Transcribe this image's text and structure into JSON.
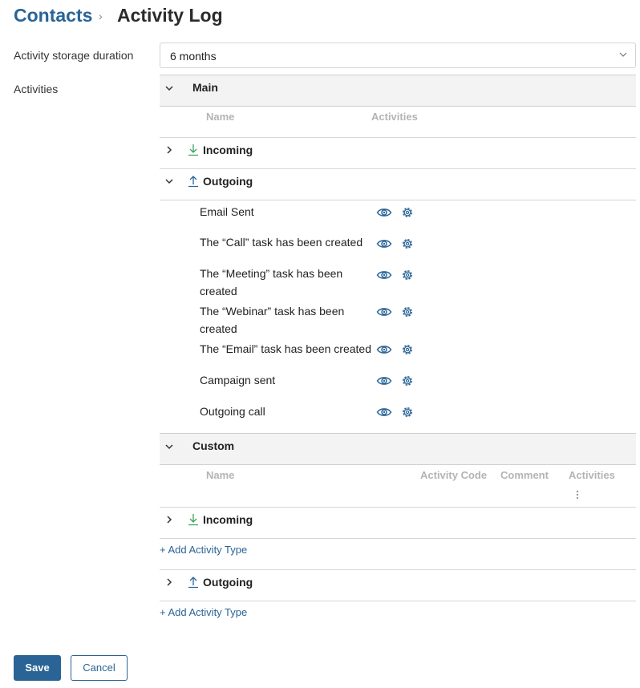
{
  "breadcrumb": {
    "root": "Contacts",
    "separator": "›",
    "title": "Activity Log"
  },
  "form": {
    "storage_label": "Activity storage duration",
    "storage_value": "6 months",
    "activities_label": "Activities"
  },
  "main_section": {
    "title": "Main",
    "columns": [
      "Name",
      "Activities"
    ],
    "incoming_label": "Incoming",
    "outgoing_label": "Outgoing",
    "outgoing_items": [
      "Email Sent",
      "The “Call” task has been created",
      "The “Meeting” task has been created",
      "The “Webinar” task has been created",
      "The “Email” task has been created",
      "Campaign sent",
      "Outgoing call"
    ]
  },
  "custom_section": {
    "title": "Custom",
    "columns": [
      "Name",
      "Activity Code",
      "Comment",
      "Activities"
    ],
    "incoming_label": "Incoming",
    "outgoing_label": "Outgoing",
    "add_label_1": "+ Add Activity Type",
    "add_label_2": "+ Add Activity Type"
  },
  "actions": {
    "save": "Save",
    "cancel": "Cancel"
  },
  "colors": {
    "accent": "#2a6496",
    "incoming_icon": "#3aa35a",
    "outgoing_icon": "#2a6496"
  },
  "icons": [
    "chevron-right-icon",
    "chevron-down-icon",
    "incoming-icon",
    "outgoing-icon",
    "eye-icon",
    "gear-icon",
    "more-vertical-icon"
  ]
}
